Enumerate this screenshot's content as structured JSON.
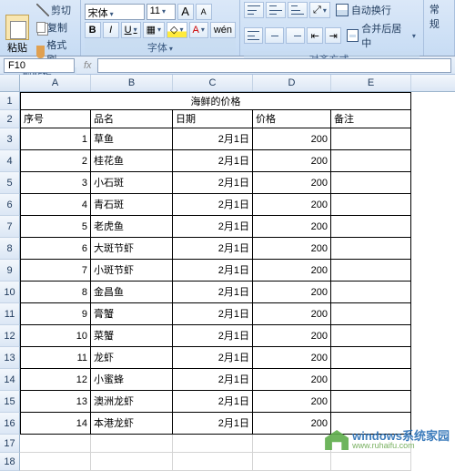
{
  "ribbon": {
    "clipboard": {
      "label": "剪贴板",
      "paste": "粘贴",
      "cut": "剪切",
      "copy": "复制",
      "format_painter": "格式刷"
    },
    "font": {
      "label": "字体",
      "family": "宋体",
      "size": "11",
      "size_up": "A",
      "size_down": "A",
      "bold": "B",
      "italic": "I",
      "underline": "U"
    },
    "alignment": {
      "label": "对齐方式",
      "wrap": "自动换行",
      "merge": "合并后居中"
    },
    "number": {
      "label": "常规"
    }
  },
  "namebox": "F10",
  "columns": [
    "A",
    "B",
    "C",
    "D",
    "E"
  ],
  "row_numbers": [
    1,
    2,
    3,
    4,
    5,
    6,
    7,
    8,
    9,
    10,
    11,
    12,
    13,
    14,
    15,
    16,
    17,
    18
  ],
  "title": "海鲜的价格",
  "headers": {
    "no": "序号",
    "name": "品名",
    "date": "日期",
    "price": "价格",
    "note": "备注"
  },
  "rows": [
    {
      "no": 1,
      "name": "草鱼",
      "date": "2月1日",
      "price": 200
    },
    {
      "no": 2,
      "name": "桂花鱼",
      "date": "2月1日",
      "price": 200
    },
    {
      "no": 3,
      "name": "小石斑",
      "date": "2月1日",
      "price": 200
    },
    {
      "no": 4,
      "name": "青石斑",
      "date": "2月1日",
      "price": 200
    },
    {
      "no": 5,
      "name": "老虎鱼",
      "date": "2月1日",
      "price": 200
    },
    {
      "no": 6,
      "name": "大斑节虾",
      "date": "2月1日",
      "price": 200
    },
    {
      "no": 7,
      "name": "小斑节虾",
      "date": "2月1日",
      "price": 200
    },
    {
      "no": 8,
      "name": "金昌鱼",
      "date": "2月1日",
      "price": 200
    },
    {
      "no": 9,
      "name": "膏蟹",
      "date": "2月1日",
      "price": 200
    },
    {
      "no": 10,
      "name": "菜蟹",
      "date": "2月1日",
      "price": 200
    },
    {
      "no": 11,
      "name": "龙虾",
      "date": "2月1日",
      "price": 200
    },
    {
      "no": 12,
      "name": "小蜜蜂",
      "date": "2月1日",
      "price": 200
    },
    {
      "no": 13,
      "name": "澳洲龙虾",
      "date": "2月1日",
      "price": 200
    },
    {
      "no": 14,
      "name": "本港龙虾",
      "date": "2月1日",
      "price": 200
    }
  ],
  "watermark": {
    "main": "windows系统家园",
    "sub": "www.ruhaifu.com"
  }
}
